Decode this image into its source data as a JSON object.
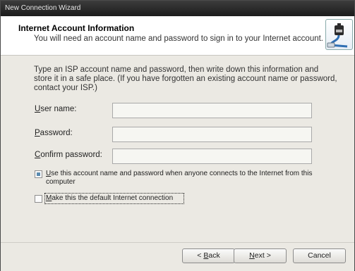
{
  "window": {
    "title": "New Connection Wizard"
  },
  "header": {
    "title": "Internet Account Information",
    "subtitle": "You will need an account name and password to sign in to your Internet account.",
    "icon": "network-cable-icon"
  },
  "intro": "Type an ISP account name and password, then write down this information and store it in a safe place. (If you have forgotten an existing account name or password, contact your ISP.)",
  "form": {
    "username": {
      "label_u": "U",
      "label_rest": "ser name:",
      "value": ""
    },
    "password": {
      "label_u": "P",
      "label_rest": "assword:",
      "value": ""
    },
    "confirm": {
      "label_u": "C",
      "label_rest": "onfirm password:",
      "value": ""
    }
  },
  "options": {
    "use_for_all": {
      "label_u": "U",
      "label_rest": "se this account  name and password when anyone connects to the Internet from this computer",
      "checked": true
    },
    "make_default": {
      "label_u": "M",
      "label_rest": "ake this the default Internet connection",
      "checked": false
    }
  },
  "buttons": {
    "back": {
      "pre": "< ",
      "u": "B",
      "rest": "ack"
    },
    "next": {
      "u": "N",
      "rest": "ext >"
    },
    "cancel": {
      "label": "Cancel"
    }
  }
}
